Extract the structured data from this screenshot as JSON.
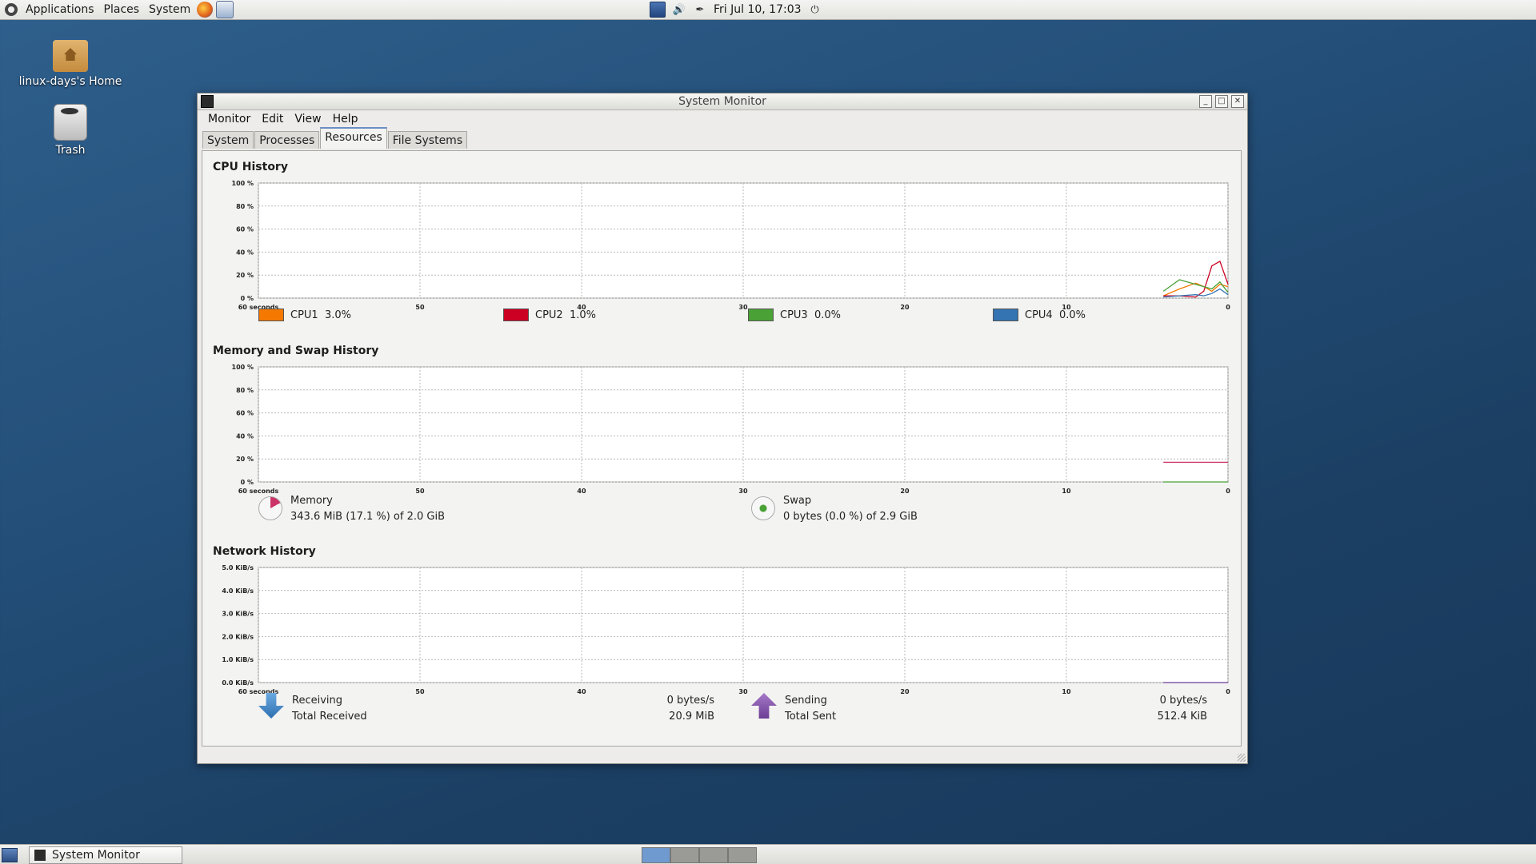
{
  "top_panel": {
    "menus": [
      "Applications",
      "Places",
      "System"
    ],
    "clock": "Fri Jul 10, 17:03"
  },
  "desktop_icons": [
    {
      "label": "linux-days's Home"
    },
    {
      "label": "Trash"
    }
  ],
  "window": {
    "title": "System Monitor",
    "menus": [
      "Monitor",
      "Edit",
      "View",
      "Help"
    ],
    "tabs": [
      "System",
      "Processes",
      "Resources",
      "File Systems"
    ],
    "active_tab": "Resources"
  },
  "cpu": {
    "title": "CPU History",
    "legend": [
      {
        "name": "CPU1",
        "value": "3.0%",
        "color": "#f57900"
      },
      {
        "name": "CPU2",
        "value": "1.0%",
        "color": "#cc0022"
      },
      {
        "name": "CPU3",
        "value": "0.0%",
        "color": "#4aa136"
      },
      {
        "name": "CPU4",
        "value": "0.0%",
        "color": "#3474b2"
      }
    ]
  },
  "memory": {
    "title": "Memory and Swap History",
    "mem_label": "Memory",
    "mem_value": "343.6 MiB (17.1 %) of 2.0 GiB",
    "swap_label": "Swap",
    "swap_value": "0 bytes (0.0 %) of 2.9 GiB"
  },
  "network": {
    "title": "Network History",
    "receiving_label": "Receiving",
    "receiving_value": "0 bytes/s",
    "total_received_label": "Total Received",
    "total_received_value": "20.9 MiB",
    "sending_label": "Sending",
    "sending_value": "0 bytes/s",
    "total_sent_label": "Total Sent",
    "total_sent_value": "512.4 KiB"
  },
  "chart_data": [
    {
      "type": "line",
      "title": "CPU History",
      "x_ticks": [
        "60 seconds",
        "50",
        "40",
        "30",
        "20",
        "10",
        "0"
      ],
      "y_ticks": [
        "100 %",
        "80 %",
        "60 %",
        "40 %",
        "20 %",
        "0 %"
      ],
      "ylim": [
        0,
        100
      ],
      "xlim": [
        60,
        0
      ],
      "series": [
        {
          "name": "CPU1",
          "color": "#f57900",
          "x": [
            4,
            3,
            2,
            1.5,
            1,
            0.5,
            0
          ],
          "y": [
            2,
            8,
            13,
            10,
            6,
            12,
            10
          ]
        },
        {
          "name": "CPU2",
          "color": "#cc0022",
          "x": [
            4,
            3,
            2,
            1.5,
            1,
            0.5,
            0
          ],
          "y": [
            2,
            2,
            1,
            6,
            28,
            32,
            12
          ]
        },
        {
          "name": "CPU3",
          "color": "#4aa136",
          "x": [
            4,
            3,
            2,
            1.5,
            1,
            0.5,
            0
          ],
          "y": [
            6,
            16,
            12,
            10,
            8,
            14,
            5
          ]
        },
        {
          "name": "CPU4",
          "color": "#3474b2",
          "x": [
            4,
            3,
            2,
            1.5,
            1,
            0.5,
            0
          ],
          "y": [
            1,
            2,
            3,
            2,
            4,
            8,
            3
          ]
        }
      ]
    },
    {
      "type": "line",
      "title": "Memory and Swap History",
      "x_ticks": [
        "60 seconds",
        "50",
        "40",
        "30",
        "20",
        "10",
        "0"
      ],
      "y_ticks": [
        "100 %",
        "80 %",
        "60 %",
        "40 %",
        "20 %",
        "0 %"
      ],
      "ylim": [
        0,
        100
      ],
      "xlim": [
        60,
        0
      ],
      "series": [
        {
          "name": "Memory",
          "color": "#cc3366",
          "x": [
            4,
            0
          ],
          "y": [
            17.1,
            17.1
          ]
        },
        {
          "name": "Swap",
          "color": "#4aa136",
          "x": [
            4,
            0
          ],
          "y": [
            0,
            0
          ]
        }
      ]
    },
    {
      "type": "line",
      "title": "Network History",
      "x_ticks": [
        "60 seconds",
        "50",
        "40",
        "30",
        "20",
        "10",
        "0"
      ],
      "y_ticks": [
        "5.0 KiB/s",
        "4.0 KiB/s",
        "3.0 KiB/s",
        "2.0 KiB/s",
        "1.0 KiB/s",
        "0.0 KiB/s"
      ],
      "ylim": [
        0,
        5
      ],
      "xlim": [
        60,
        0
      ],
      "series": [
        {
          "name": "Receiving",
          "color": "#3474b2",
          "x": [
            4,
            0
          ],
          "y": [
            0,
            0
          ]
        },
        {
          "name": "Sending",
          "color": "#8b4ea6",
          "x": [
            4,
            0
          ],
          "y": [
            0,
            0
          ]
        }
      ]
    }
  ]
}
